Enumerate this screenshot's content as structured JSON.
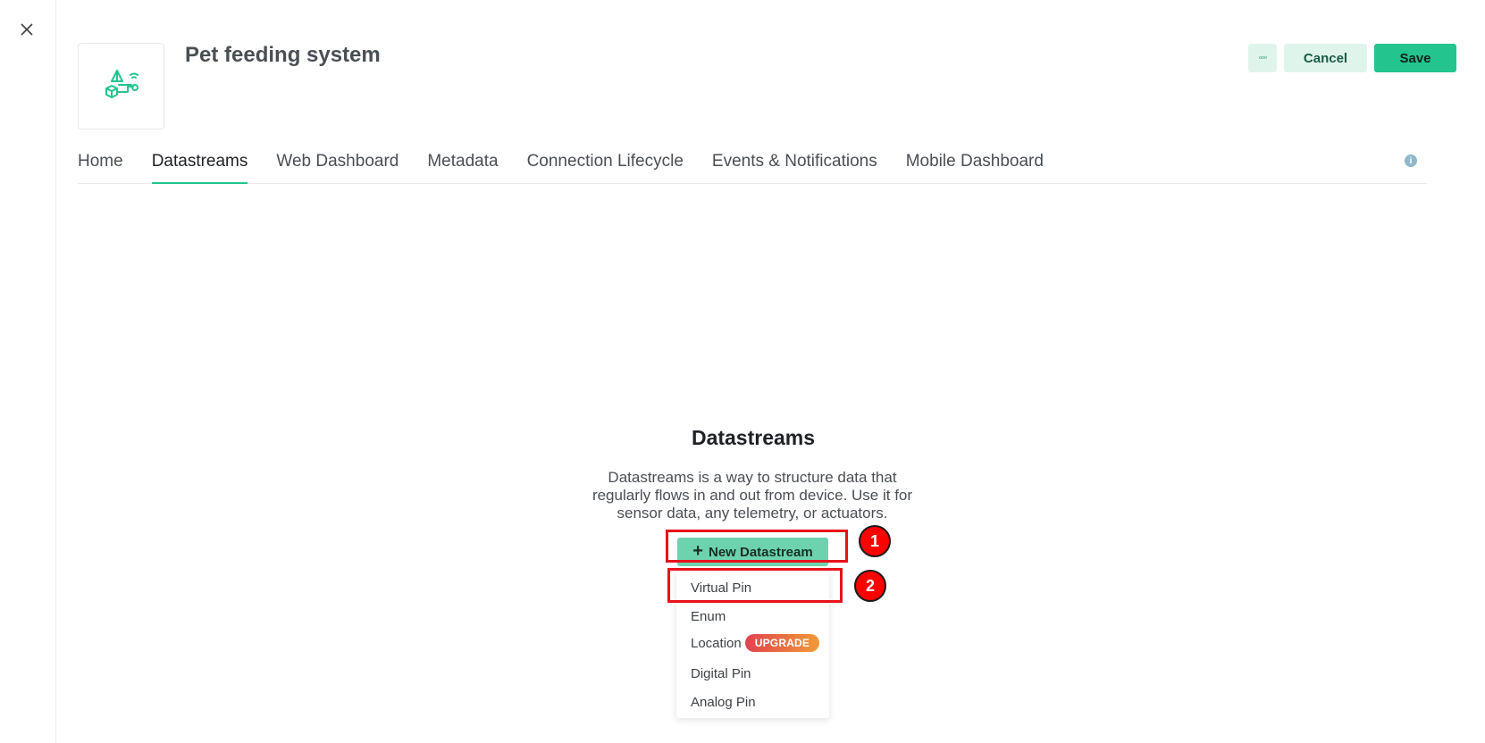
{
  "header": {
    "title": "Pet feeding system",
    "more_label": "◦◦◦",
    "cancel_label": "Cancel",
    "save_label": "Save",
    "logo_icon": "pet-feeder-template-icon"
  },
  "tabs": [
    {
      "label": "Home",
      "active": false
    },
    {
      "label": "Datastreams",
      "active": true
    },
    {
      "label": "Web Dashboard",
      "active": false
    },
    {
      "label": "Metadata",
      "active": false
    },
    {
      "label": "Connection Lifecycle",
      "active": false
    },
    {
      "label": "Events & Notifications",
      "active": false
    },
    {
      "label": "Mobile Dashboard",
      "active": false
    }
  ],
  "info_icon_glyph": "i",
  "empty_state": {
    "title": "Datastreams",
    "description": "Datastreams is a way to structure data that regularly flows in and out from device. Use it for sensor data, any telemetry, or actuators.",
    "button_plus": "+",
    "button_label": "New Datastream"
  },
  "dropdown": {
    "items": [
      {
        "label": "Virtual Pin"
      },
      {
        "label": "Enum"
      },
      {
        "label": "Location",
        "badge": "UPGRADE"
      },
      {
        "label": "Digital Pin"
      },
      {
        "label": "Analog Pin"
      }
    ]
  },
  "annotations": [
    {
      "number": "1"
    },
    {
      "number": "2"
    }
  ],
  "colors": {
    "accent": "#23c48e",
    "accent_light": "#dff5ec",
    "annotation_red": "#ff0000"
  }
}
